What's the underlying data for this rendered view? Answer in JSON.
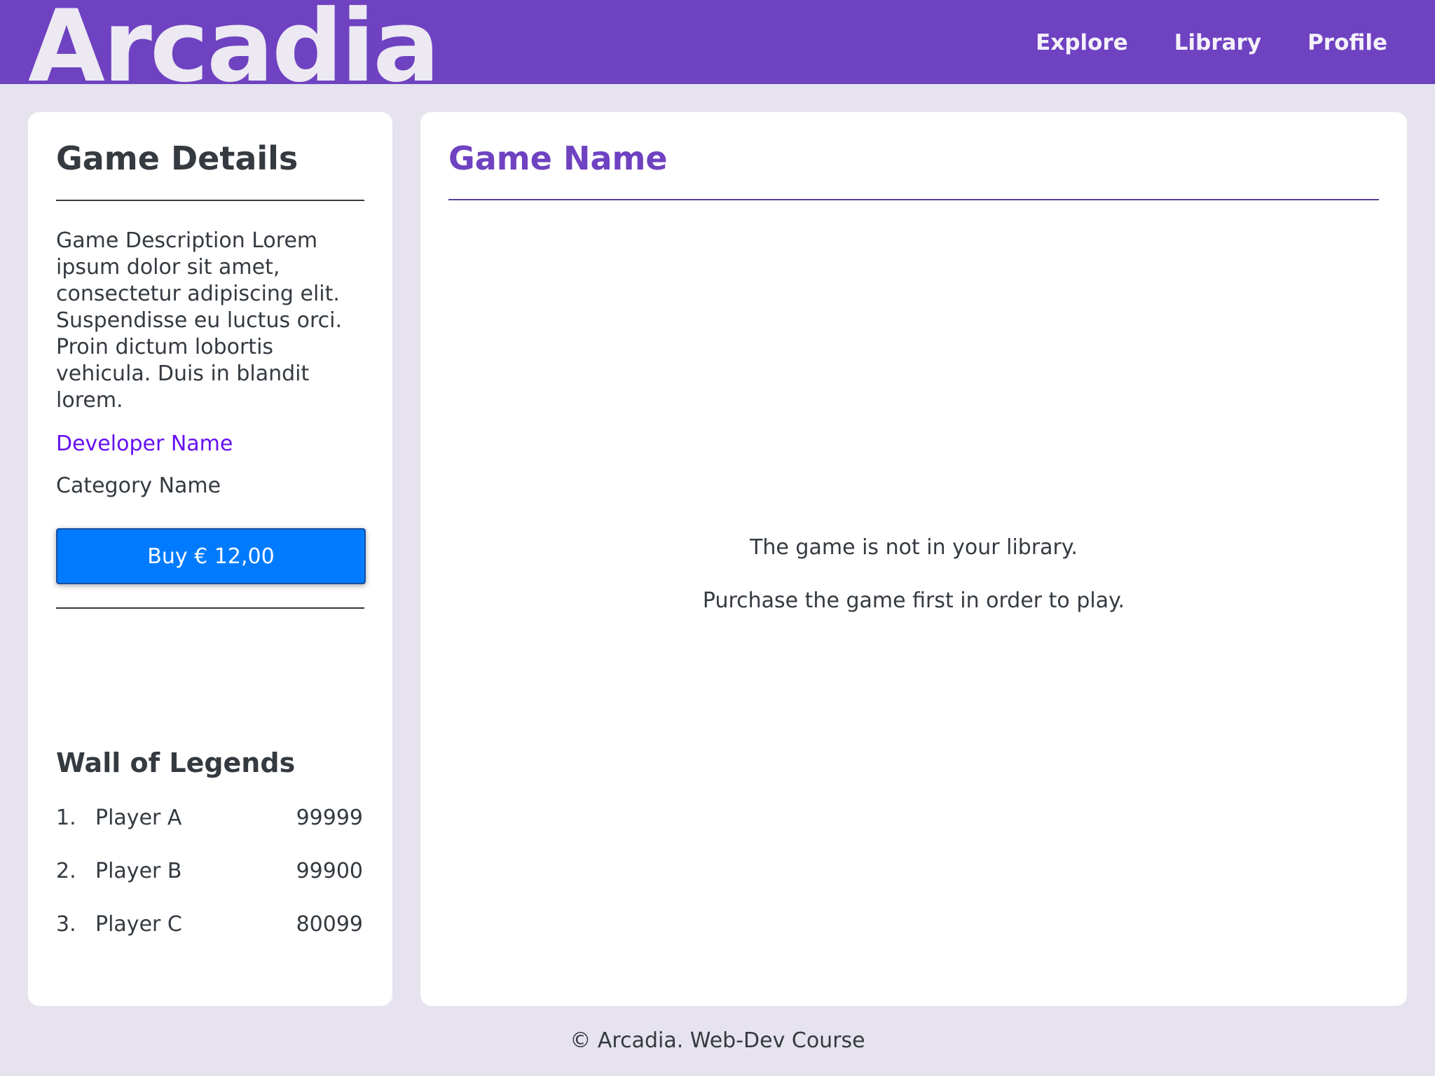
{
  "header": {
    "logo": "Arcadia",
    "nav": [
      "Explore",
      "Library",
      "Profile"
    ]
  },
  "sidebar": {
    "title": "Game Details",
    "description": "Game Description Lorem ipsum dolor sit amet, consectetur adipiscing elit. Suspendisse eu luctus orci. Proin dictum lobortis vehicula. Duis in blandit lorem.",
    "developer": "Developer Name",
    "category": "Category Name",
    "buy_label": "Buy € 12,00",
    "legends_title": "Wall of Legends",
    "legends": [
      {
        "rank": "1.",
        "player": "Player A",
        "score": "99999"
      },
      {
        "rank": "2.",
        "player": "Player B",
        "score": "99900"
      },
      {
        "rank": "3.",
        "player": "Player C",
        "score": "80099"
      }
    ]
  },
  "main": {
    "title": "Game Name",
    "message_line1": "The game is not in your library.",
    "message_line2": "Purchase the game first in order to play."
  },
  "footer": {
    "text": "© Arcadia. Web-Dev Course"
  },
  "colors": {
    "header_bg": "#6f42c1",
    "page_bg": "#e6e3ee",
    "accent": "#6f42c1",
    "developer_link": "#6610f2",
    "buy_button": "#007bff"
  }
}
